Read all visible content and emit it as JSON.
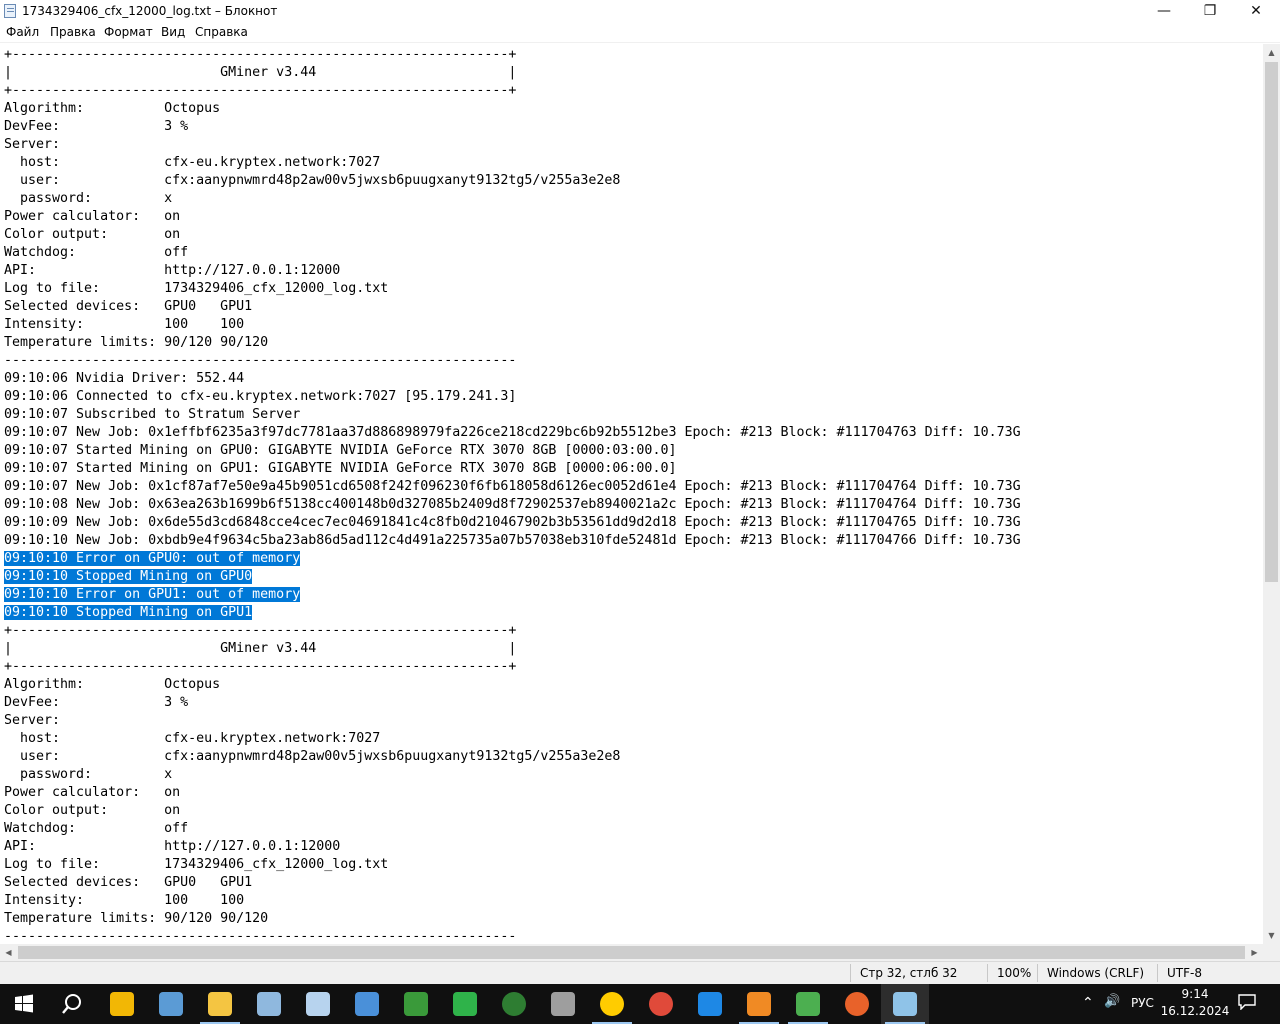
{
  "window": {
    "title": "1734329406_cfx_12000_log.txt – Блокнот",
    "min_glyph": "—",
    "max_glyph": "❐",
    "close_glyph": "✕"
  },
  "menu": [
    "Файл",
    "Правка",
    "Формат",
    "Вид",
    "Справка"
  ],
  "lines": [
    "+--------------------------------------------------------------+",
    "|                          GMiner v3.44                        |",
    "+--------------------------------------------------------------+",
    "Algorithm:          Octopus",
    "DevFee:             3 %",
    "Server:",
    "  host:             cfx-eu.kryptex.network:7027",
    "  user:             cfx:aanypnwmrd48p2aw00v5jwxsb6puugxanyt9132tg5/v255a3e2e8",
    "  password:         x",
    "Power calculator:   on",
    "Color output:       on",
    "Watchdog:           off",
    "API:                http://127.0.0.1:12000",
    "Log to file:        1734329406_cfx_12000_log.txt",
    "Selected devices:   GPU0   GPU1",
    "Intensity:          100    100",
    "Temperature limits: 90/120 90/120",
    "----------------------------------------------------------------",
    "09:10:06 Nvidia Driver: 552.44",
    "09:10:06 Connected to cfx-eu.kryptex.network:7027 [95.179.241.3]",
    "09:10:07 Subscribed to Stratum Server",
    "09:10:07 New Job: 0x1effbf6235a3f97dc7781aa37d886898979fa226ce218cd229bc6b92b5512be3 Epoch: #213 Block: #111704763 Diff: 10.73G",
    "09:10:07 Started Mining on GPU0: GIGABYTE NVIDIA GeForce RTX 3070 8GB [0000:03:00.0]",
    "09:10:07 Started Mining on GPU1: GIGABYTE NVIDIA GeForce RTX 3070 8GB [0000:06:00.0]",
    "09:10:07 New Job: 0x1cf87af7e50e9a45b9051cd6508f242f096230f6fb618058d6126ec0052d61e4 Epoch: #213 Block: #111704764 Diff: 10.73G",
    "09:10:08 New Job: 0x63ea263b1699b6f5138cc400148b0d327085b2409d8f72902537eb8940021a2c Epoch: #213 Block: #111704764 Diff: 10.73G",
    "09:10:09 New Job: 0x6de55d3cd6848cce4cec7ec04691841c4c8fb0d210467902b3b53561dd9d2d18 Epoch: #213 Block: #111704765 Diff: 10.73G",
    "09:10:10 New Job: 0xbdb9e4f9634c5ba23ab86d5ad112c4d491a225735a07b57038eb310fde52481d Epoch: #213 Block: #111704766 Diff: 10.73G",
    "09:10:10 Error on GPU0: out of memory",
    "09:10:10 Stopped Mining on GPU0",
    "09:10:10 Error on GPU1: out of memory",
    "09:10:10 Stopped Mining on GPU1",
    "+--------------------------------------------------------------+",
    "|                          GMiner v3.44                        |",
    "+--------------------------------------------------------------+",
    "Algorithm:          Octopus",
    "DevFee:             3 %",
    "Server:",
    "  host:             cfx-eu.kryptex.network:7027",
    "  user:             cfx:aanypnwmrd48p2aw00v5jwxsb6puugxanyt9132tg5/v255a3e2e8",
    "  password:         x",
    "Power calculator:   on",
    "Color output:       on",
    "Watchdog:           off",
    "API:                http://127.0.0.1:12000",
    "Log to file:        1734329406_cfx_12000_log.txt",
    "Selected devices:   GPU0   GPU1",
    "Intensity:          100    100",
    "Temperature limits: 90/120 90/120",
    "----------------------------------------------------------------"
  ],
  "selected_lines": [
    28,
    29,
    30,
    31
  ],
  "status": {
    "position": "Стр 32, стлб 32",
    "zoom": "100%",
    "line_endings": "Windows (CRLF)",
    "encoding": "UTF-8"
  },
  "taskbar": {
    "apps": [
      {
        "name": "start-button",
        "icon": "windows-icon",
        "color": "#ffffff"
      },
      {
        "name": "search-button",
        "icon": "search-icon",
        "color": "#ffffff"
      },
      {
        "name": "taskbar-app-1",
        "icon": "warning-app-icon",
        "color": "#f2b705"
      },
      {
        "name": "taskbar-app-2",
        "icon": "network-app-icon",
        "color": "#5b9bd5"
      },
      {
        "name": "taskbar-app-3",
        "icon": "folder-icon",
        "color": "#f4c542"
      },
      {
        "name": "taskbar-app-4",
        "icon": "paint-icon",
        "color": "#8fb8de"
      },
      {
        "name": "taskbar-app-5",
        "icon": "calculator-icon",
        "color": "#b7d3ee"
      },
      {
        "name": "taskbar-app-6",
        "icon": "control-panel-icon",
        "color": "#4a90d9"
      },
      {
        "name": "taskbar-app-7",
        "icon": "gpu-card-icon",
        "color": "#3a9a3a"
      },
      {
        "name": "taskbar-app-8",
        "icon": "chip-icon",
        "color": "#2fb34a"
      },
      {
        "name": "taskbar-app-9",
        "icon": "xbox-icon",
        "color": "#2e7d32"
      },
      {
        "name": "taskbar-app-10",
        "icon": "settings-app-icon",
        "color": "#9e9e9e"
      },
      {
        "name": "taskbar-app-11",
        "icon": "yandex-browser-icon",
        "color": "#ffcc00"
      },
      {
        "name": "taskbar-app-12",
        "icon": "chrome-icon",
        "color": "#e04a3a"
      },
      {
        "name": "taskbar-app-13",
        "icon": "diamond-icon",
        "color": "#1e88e5"
      },
      {
        "name": "taskbar-app-14",
        "icon": "stocks-icon",
        "color": "#f08a24"
      },
      {
        "name": "taskbar-app-15",
        "icon": "terminal-icon",
        "color": "#4caf50"
      },
      {
        "name": "taskbar-app-16",
        "icon": "xr-app-icon",
        "color": "#e8622a"
      },
      {
        "name": "taskbar-app-17",
        "icon": "notepad-icon",
        "color": "#8fc3e8"
      }
    ],
    "tray": {
      "chevron": "⌃",
      "volume": "🔊",
      "language": "РУС",
      "time": "9:14",
      "date": "16.12.2024"
    }
  }
}
